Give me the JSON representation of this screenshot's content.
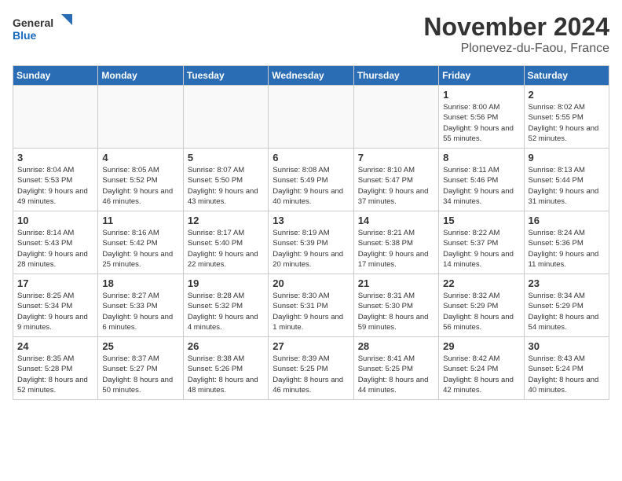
{
  "header": {
    "logo_line1": "General",
    "logo_line2": "Blue",
    "month_title": "November 2024",
    "location": "Plonevez-du-Faou, France"
  },
  "weekdays": [
    "Sunday",
    "Monday",
    "Tuesday",
    "Wednesday",
    "Thursday",
    "Friday",
    "Saturday"
  ],
  "weeks": [
    [
      {
        "day": "",
        "info": ""
      },
      {
        "day": "",
        "info": ""
      },
      {
        "day": "",
        "info": ""
      },
      {
        "day": "",
        "info": ""
      },
      {
        "day": "",
        "info": ""
      },
      {
        "day": "1",
        "info": "Sunrise: 8:00 AM\nSunset: 5:56 PM\nDaylight: 9 hours and 55 minutes."
      },
      {
        "day": "2",
        "info": "Sunrise: 8:02 AM\nSunset: 5:55 PM\nDaylight: 9 hours and 52 minutes."
      }
    ],
    [
      {
        "day": "3",
        "info": "Sunrise: 8:04 AM\nSunset: 5:53 PM\nDaylight: 9 hours and 49 minutes."
      },
      {
        "day": "4",
        "info": "Sunrise: 8:05 AM\nSunset: 5:52 PM\nDaylight: 9 hours and 46 minutes."
      },
      {
        "day": "5",
        "info": "Sunrise: 8:07 AM\nSunset: 5:50 PM\nDaylight: 9 hours and 43 minutes."
      },
      {
        "day": "6",
        "info": "Sunrise: 8:08 AM\nSunset: 5:49 PM\nDaylight: 9 hours and 40 minutes."
      },
      {
        "day": "7",
        "info": "Sunrise: 8:10 AM\nSunset: 5:47 PM\nDaylight: 9 hours and 37 minutes."
      },
      {
        "day": "8",
        "info": "Sunrise: 8:11 AM\nSunset: 5:46 PM\nDaylight: 9 hours and 34 minutes."
      },
      {
        "day": "9",
        "info": "Sunrise: 8:13 AM\nSunset: 5:44 PM\nDaylight: 9 hours and 31 minutes."
      }
    ],
    [
      {
        "day": "10",
        "info": "Sunrise: 8:14 AM\nSunset: 5:43 PM\nDaylight: 9 hours and 28 minutes."
      },
      {
        "day": "11",
        "info": "Sunrise: 8:16 AM\nSunset: 5:42 PM\nDaylight: 9 hours and 25 minutes."
      },
      {
        "day": "12",
        "info": "Sunrise: 8:17 AM\nSunset: 5:40 PM\nDaylight: 9 hours and 22 minutes."
      },
      {
        "day": "13",
        "info": "Sunrise: 8:19 AM\nSunset: 5:39 PM\nDaylight: 9 hours and 20 minutes."
      },
      {
        "day": "14",
        "info": "Sunrise: 8:21 AM\nSunset: 5:38 PM\nDaylight: 9 hours and 17 minutes."
      },
      {
        "day": "15",
        "info": "Sunrise: 8:22 AM\nSunset: 5:37 PM\nDaylight: 9 hours and 14 minutes."
      },
      {
        "day": "16",
        "info": "Sunrise: 8:24 AM\nSunset: 5:36 PM\nDaylight: 9 hours and 11 minutes."
      }
    ],
    [
      {
        "day": "17",
        "info": "Sunrise: 8:25 AM\nSunset: 5:34 PM\nDaylight: 9 hours and 9 minutes."
      },
      {
        "day": "18",
        "info": "Sunrise: 8:27 AM\nSunset: 5:33 PM\nDaylight: 9 hours and 6 minutes."
      },
      {
        "day": "19",
        "info": "Sunrise: 8:28 AM\nSunset: 5:32 PM\nDaylight: 9 hours and 4 minutes."
      },
      {
        "day": "20",
        "info": "Sunrise: 8:30 AM\nSunset: 5:31 PM\nDaylight: 9 hours and 1 minute."
      },
      {
        "day": "21",
        "info": "Sunrise: 8:31 AM\nSunset: 5:30 PM\nDaylight: 8 hours and 59 minutes."
      },
      {
        "day": "22",
        "info": "Sunrise: 8:32 AM\nSunset: 5:29 PM\nDaylight: 8 hours and 56 minutes."
      },
      {
        "day": "23",
        "info": "Sunrise: 8:34 AM\nSunset: 5:29 PM\nDaylight: 8 hours and 54 minutes."
      }
    ],
    [
      {
        "day": "24",
        "info": "Sunrise: 8:35 AM\nSunset: 5:28 PM\nDaylight: 8 hours and 52 minutes."
      },
      {
        "day": "25",
        "info": "Sunrise: 8:37 AM\nSunset: 5:27 PM\nDaylight: 8 hours and 50 minutes."
      },
      {
        "day": "26",
        "info": "Sunrise: 8:38 AM\nSunset: 5:26 PM\nDaylight: 8 hours and 48 minutes."
      },
      {
        "day": "27",
        "info": "Sunrise: 8:39 AM\nSunset: 5:25 PM\nDaylight: 8 hours and 46 minutes."
      },
      {
        "day": "28",
        "info": "Sunrise: 8:41 AM\nSunset: 5:25 PM\nDaylight: 8 hours and 44 minutes."
      },
      {
        "day": "29",
        "info": "Sunrise: 8:42 AM\nSunset: 5:24 PM\nDaylight: 8 hours and 42 minutes."
      },
      {
        "day": "30",
        "info": "Sunrise: 8:43 AM\nSunset: 5:24 PM\nDaylight: 8 hours and 40 minutes."
      }
    ]
  ]
}
